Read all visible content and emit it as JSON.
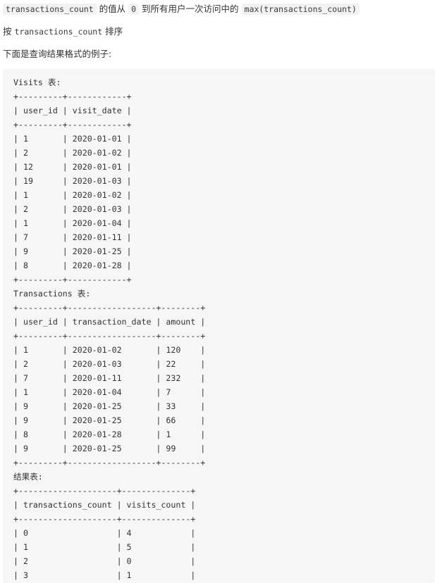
{
  "intro": {
    "line1": {
      "code_a": "transactions_count",
      "text_a": "的值从",
      "code_b": "0",
      "text_b": "到所有用户一次访问中的",
      "code_c": "max(transactions_count)"
    },
    "line2": {
      "text_a": "按",
      "code_a": "transactions_count",
      "text_b": "排序"
    },
    "line3": "下面是查询结果格式的例子:"
  },
  "example_block": {
    "lines": [
      "Visits 表:",
      "+---------+------------+",
      "| user_id | visit_date |",
      "+---------+------------+",
      "| 1       | 2020-01-01 |",
      "| 2       | 2020-01-02 |",
      "| 12      | 2020-01-01 |",
      "| 19      | 2020-01-03 |",
      "| 1       | 2020-01-02 |",
      "| 2       | 2020-01-03 |",
      "| 1       | 2020-01-04 |",
      "| 7       | 2020-01-11 |",
      "| 9       | 2020-01-25 |",
      "| 8       | 2020-01-28 |",
      "+---------+------------+",
      "Transactions 表:",
      "+---------+------------------+--------+",
      "| user_id | transaction_date | amount |",
      "+---------+------------------+--------+",
      "| 1       | 2020-01-02       | 120    |",
      "| 2       | 2020-01-03       | 22     |",
      "| 7       | 2020-01-11       | 232    |",
      "| 1       | 2020-01-04       | 7      |",
      "| 9       | 2020-01-25       | 33     |",
      "| 9       | 2020-01-25       | 66     |",
      "| 8       | 2020-01-28       | 1      |",
      "| 9       | 2020-01-25       | 99     |",
      "+---------+------------------+--------+",
      "结果表:",
      "+--------------------+--------------+",
      "| transactions_count | visits_count |",
      "+--------------------+--------------+",
      "| 0                  | 4            |",
      "| 1                  | 5            |",
      "| 2                  | 0            |",
      "| 3                  | 1            |",
      "+--------------------+--------------+"
    ]
  }
}
